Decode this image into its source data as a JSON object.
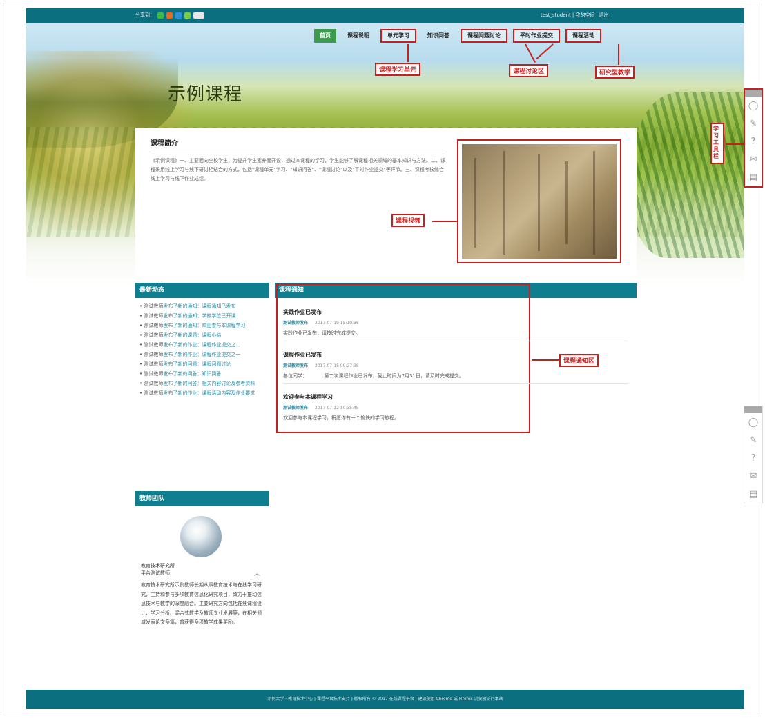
{
  "topbar": {
    "left_label": "分享到：",
    "right_links": [
      "test_student | 我的空间",
      "退出"
    ]
  },
  "nav": {
    "items": [
      {
        "label": "首页",
        "state": "active"
      },
      {
        "label": "课程说明",
        "state": "normal"
      },
      {
        "label": "单元学习",
        "state": "boxed"
      },
      {
        "label": "知识问答",
        "state": "normal"
      },
      {
        "label": "课程问题讨论",
        "state": "boxed"
      },
      {
        "label": "平时作业提交",
        "state": "boxed"
      },
      {
        "label": "课程活动",
        "state": "boxed"
      }
    ]
  },
  "hero": {
    "title": "示例课程"
  },
  "callouts": {
    "unit_learning": "课程学习单元",
    "discussion": "课程讨论区",
    "research_teaching": "研究型教学",
    "video": "课程视频",
    "notice_area": "课程通知区",
    "study_tools": "学习工具栏"
  },
  "intro": {
    "heading": "课程简介",
    "text": "《示例课程》一、主要面向全校学生，为提升学生素养而开设，通过本课程的学习，学生能够了解课程相关领域的基本知识与方法。二、课程采用线上学习与线下研讨相结合的方式，包括\"课程单元\"学习、\"知识问答\"、\"课程讨论\"以及\"平时作业提交\"等环节。三、课程考核综合线上学习与线下作业成绩。"
  },
  "news": {
    "heading": "最新动态",
    "items": [
      {
        "who": "测试教师",
        "text": "发布了新的通知：课程通知已发布"
      },
      {
        "who": "测试教师",
        "text": "发布了新的通知：学校学位已开课"
      },
      {
        "who": "测试教师",
        "text": "发布了新的通知：欢迎参与本课程学习"
      },
      {
        "who": "测试教师",
        "text": "发布了新的课题：课程小结"
      },
      {
        "who": "测试教师",
        "text": "发布了新的作业：课程作业提交之二"
      },
      {
        "who": "测试教师",
        "text": "发布了新的作业：课程作业提交之一"
      },
      {
        "who": "测试教师",
        "text": "发布了新的问题：课程问题讨论"
      },
      {
        "who": "测试教师",
        "text": "发布了新的问答：知识问答"
      },
      {
        "who": "测试教师",
        "text": "发布了新的问答：相关内容讨论及参考资料"
      },
      {
        "who": "测试教师",
        "text": "发布了新的作业：课程活动内容及作业要求"
      }
    ]
  },
  "team": {
    "heading": "教师团队",
    "name_line1": "教育技术研究所",
    "name_line2": "平台测试教师",
    "bio": "教育技术研究所示例教师长期从事教育技术与在线学习研究，主持和参与多项教育信息化研究项目，致力于推动信息技术与教学的深度融合。主要研究方向包括在线课程设计、学习分析、混合式教学及教师专业发展等，在相关领域发表论文多篇，曾获得多项教学成果奖励。"
  },
  "notices": {
    "heading": "课程通知",
    "items": [
      {
        "title": "实践作业已发布",
        "who": "测试教师发布",
        "date": "2017-07-19 15:10:36",
        "content": "实践作业已发布，请按时完成提交。"
      },
      {
        "title": "课程作业已发布",
        "who": "测试教师发布",
        "date": "2017-07-15 09:27:38",
        "content": "各位同学：　　　　第二次课程作业已发布，截止时间为7月31日，请及时完成提交。"
      },
      {
        "title": "欢迎参与本课程学习",
        "who": "测试教师发布",
        "date": "2017-07-12 10:35:45",
        "content": "欢迎参与本课程学习，祝愿你有一个愉快的学习旅程。"
      }
    ]
  },
  "tools": {
    "icons": [
      "chat-icon",
      "edit-icon",
      "help-icon",
      "mail-icon",
      "note-icon"
    ]
  },
  "footer": {
    "text": "示例大学 · 教育技术中心 | 课程平台技术支持 | 版权所有 © 2017 在线课程平台 | 建议使用 Chrome 或 Firefox 浏览器访问本站"
  }
}
